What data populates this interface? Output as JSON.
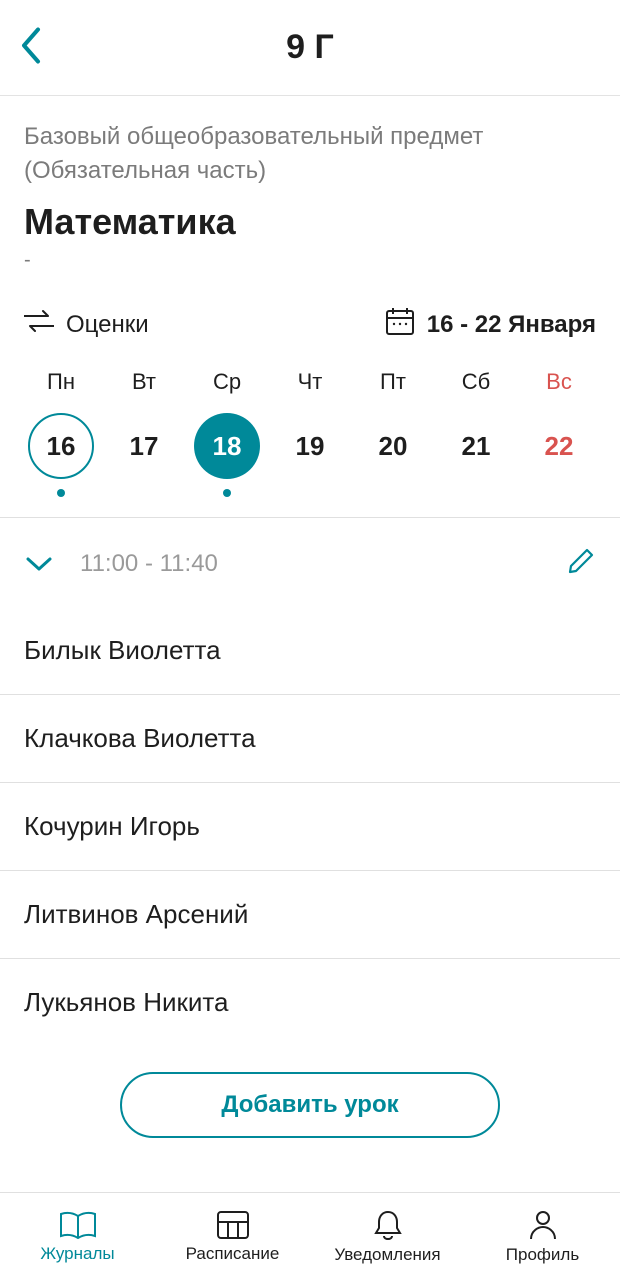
{
  "header": {
    "title": "9 Г"
  },
  "type_line": "Базовый общеобразовательный предмет (Обязательная часть)",
  "subject": "Математика",
  "dash": "-",
  "switch_label": "Оценки",
  "date_range": "16 - 22 Января",
  "week": {
    "days": [
      {
        "dow": "Пн",
        "num": "16",
        "outline": true,
        "selected": false,
        "dot": true,
        "weekend": false
      },
      {
        "dow": "Вт",
        "num": "17",
        "outline": false,
        "selected": false,
        "dot": false,
        "weekend": false
      },
      {
        "dow": "Ср",
        "num": "18",
        "outline": false,
        "selected": true,
        "dot": true,
        "weekend": false
      },
      {
        "dow": "Чт",
        "num": "19",
        "outline": false,
        "selected": false,
        "dot": false,
        "weekend": false
      },
      {
        "dow": "Пт",
        "num": "20",
        "outline": false,
        "selected": false,
        "dot": false,
        "weekend": false
      },
      {
        "dow": "Сб",
        "num": "21",
        "outline": false,
        "selected": false,
        "dot": false,
        "weekend": false
      },
      {
        "dow": "Вс",
        "num": "22",
        "outline": false,
        "selected": false,
        "dot": false,
        "weekend": true
      }
    ]
  },
  "lesson_time": "11:00 - 11:40",
  "students": [
    "Билык Виолетта",
    "Клачкова Виолетта",
    "Кочурин Игорь",
    "Литвинов Арсений",
    "Лукьянов Никита"
  ],
  "add_lesson": "Добавить урок",
  "tabs": {
    "journals": "Журналы",
    "schedule": "Расписание",
    "notifications": "Уведомления",
    "profile": "Профиль"
  }
}
